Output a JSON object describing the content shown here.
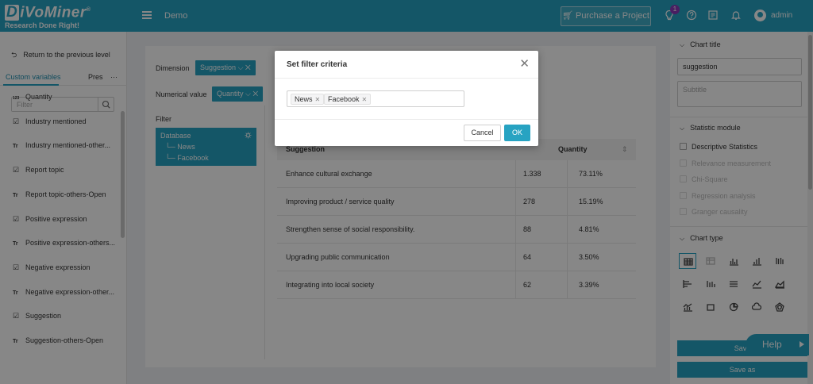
{
  "header": {
    "logo_main": "DiVoMiner",
    "logo_tagline": "Research Done Right!",
    "project_title": "Demo",
    "purchase_label": "Purchase a Project",
    "notification_badge": "1",
    "username": "admin",
    "accent_color": "#27a3c2"
  },
  "sidebar": {
    "back_label": "Return to the previous level",
    "tabs": [
      "Custom variables",
      "Pres",
      "···"
    ],
    "filter_placeholder": "Filter",
    "items": [
      {
        "type": "123",
        "label": "Quantity"
      },
      {
        "type": "check",
        "label": "Industry mentioned"
      },
      {
        "type": "Tr",
        "label": "Industry mentioned-other..."
      },
      {
        "type": "check",
        "label": "Report topic"
      },
      {
        "type": "Tr",
        "label": "Report topic-others-Open"
      },
      {
        "type": "check",
        "label": "Positive expression"
      },
      {
        "type": "Tr",
        "label": "Positive expression-others..."
      },
      {
        "type": "check",
        "label": "Negative expression"
      },
      {
        "type": "Tr",
        "label": "Negative expression-other..."
      },
      {
        "type": "check",
        "label": "Suggestion"
      },
      {
        "type": "Tr",
        "label": "Suggestion-others-Open"
      }
    ]
  },
  "main": {
    "dimension_label": "Dimension",
    "dimension_chip": "Suggestion",
    "numerical_label": "Numerical value",
    "numerical_chip": "Quantity",
    "filter_label": "Filter",
    "filter_tree": {
      "root": "Database",
      "children": [
        "News",
        "Facebook"
      ]
    },
    "table": {
      "headers": [
        "Suggestion",
        "Quantity"
      ],
      "rows": [
        {
          "label": "Enhance cultural exchange",
          "count": "1.338",
          "pct": "73.11%"
        },
        {
          "label": "Improving product / service quality",
          "count": "278",
          "pct": "15.19%"
        },
        {
          "label": "Strengthen sense of social responsibility.",
          "count": "88",
          "pct": "4.81%"
        },
        {
          "label": "Upgrading public communication",
          "count": "64",
          "pct": "3.50%"
        },
        {
          "label": "Integrating into local society",
          "count": "62",
          "pct": "3.39%"
        }
      ]
    }
  },
  "right_panel": {
    "chart_title_section": "Chart title",
    "chart_title_value": "suggestion",
    "subtitle_placeholder": "Subtitle",
    "statistic_section": "Statistic module",
    "statistic_options": [
      {
        "label": "Descriptive Statistics",
        "enabled": true
      },
      {
        "label": "Relevance measurement",
        "enabled": false
      },
      {
        "label": "Chi-Square",
        "enabled": false
      },
      {
        "label": "Regression analysis",
        "enabled": false
      },
      {
        "label": "Granger causality",
        "enabled": false
      }
    ],
    "chart_type_section": "Chart type",
    "save_label": "Save",
    "save_as_label": "Save as",
    "help_label": "Help"
  },
  "modal": {
    "title": "Set filter criteria",
    "tags": [
      "News",
      "Facebook"
    ],
    "cancel_label": "Cancel",
    "ok_label": "OK"
  }
}
